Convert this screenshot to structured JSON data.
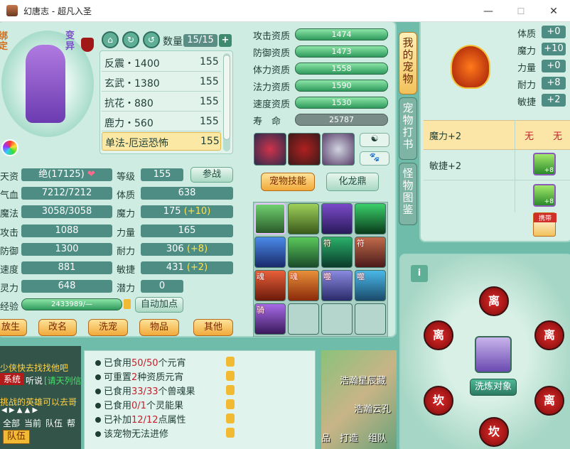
{
  "window": {
    "title": "幻唐志 - 超凡入圣",
    "minimize": "—",
    "maximize": "☐",
    "close": "✕"
  },
  "pet": {
    "tag_bound": "绑定",
    "tag_mutant": "变异",
    "count_label": "数量",
    "count_value": "15/15",
    "add": "+"
  },
  "pet_list": [
    {
      "name": "反震・1400",
      "level": "155"
    },
    {
      "name": "玄武・1380",
      "level": "155"
    },
    {
      "name": "抗花・880",
      "level": "155"
    },
    {
      "name": "鹿力・560",
      "level": "155"
    },
    {
      "name": "单法-厄运恐怖",
      "level": "155"
    }
  ],
  "stats": {
    "talent": {
      "label": "天资",
      "value": "绝(17125)"
    },
    "hp": {
      "label": "气血",
      "value": "7212/7212"
    },
    "mp": {
      "label": "魔法",
      "value": "3058/3058"
    },
    "atk": {
      "label": "攻击",
      "value": "1088"
    },
    "def": {
      "label": "防御",
      "value": "1300"
    },
    "spd": {
      "label": "速度",
      "value": "881"
    },
    "spi": {
      "label": "灵力",
      "value": "648"
    },
    "exp": {
      "label": "经验",
      "value": "2433989/—"
    },
    "level": {
      "label": "等级",
      "value": "155"
    },
    "con": {
      "label": "体质",
      "value": "638"
    },
    "mag": {
      "label": "魔力",
      "value": "175",
      "bonus": "(+10)"
    },
    "str": {
      "label": "力量",
      "value": "165"
    },
    "end": {
      "label": "耐力",
      "value": "306",
      "bonus": "(+8)"
    },
    "agi": {
      "label": "敏捷",
      "value": "431",
      "bonus": "(+2)"
    },
    "pot": {
      "label": "潜力",
      "value": "0"
    },
    "fight_btn": "参战",
    "auto_btn": "自动加点"
  },
  "bottom_buttons": [
    "放生",
    "改名",
    "洗宠",
    "物品",
    "其他"
  ],
  "aptitude": [
    {
      "label": "攻击资质",
      "value": "1474"
    },
    {
      "label": "防御资质",
      "value": "1473"
    },
    {
      "label": "体力资质",
      "value": "1558"
    },
    {
      "label": "法力资质",
      "value": "1590"
    },
    {
      "label": "速度资质",
      "value": "1530"
    },
    {
      "label": "寿　命",
      "value": "25787"
    }
  ],
  "skill_tabs": {
    "skills": "宠物技能",
    "dragon": "化龙鼎"
  },
  "skill_marks": {
    "fu": "符",
    "hun": "魂",
    "shi": "噬",
    "qi": "骑"
  },
  "side_tabs": [
    "我的宠物",
    "宠物打书",
    "怪物图鉴"
  ],
  "wash": {
    "attrs": [
      {
        "label": "体质",
        "value": "+0"
      },
      {
        "label": "魔力",
        "value": "+10"
      },
      {
        "label": "力量",
        "value": "+0"
      },
      {
        "label": "耐力",
        "value": "+8"
      },
      {
        "label": "敏捷",
        "value": "+2"
      }
    ],
    "rows": [
      {
        "text": "魔力+2",
        "a": "无",
        "b": "无"
      },
      {
        "text": "敏捷+2"
      }
    ],
    "badge": "+8",
    "carry": "携带",
    "target": "洗炼对象",
    "info": "i"
  },
  "circles": [
    "离",
    "离",
    "离",
    "坎",
    "离",
    "坎"
  ],
  "notes": [
    {
      "pre": "已食用",
      "hl": "50/50",
      "post": "个元宵"
    },
    {
      "pre": "可重置",
      "hl": "2",
      "post": "种资质元宵"
    },
    {
      "pre": "已食用",
      "hl": "33/33",
      "post": "个兽魂果"
    },
    {
      "pre": "已食用",
      "hl": "0/1",
      "post": "个灵能果"
    },
    {
      "pre": "已补加",
      "hl": "12/12",
      "post": "点属性"
    },
    {
      "pre": "该宠物无法进修",
      "hl": "",
      "post": ""
    }
  ],
  "chat": {
    "line1": "少侠快去找找他吧",
    "sys": "系统",
    "line2a": "听说",
    "line2b": "[请天列信",
    "line3": "挑战的英雄可以去哥",
    "tabs": [
      "全部",
      "当前",
      "队伍",
      "帮"
    ],
    "team": "队伍"
  },
  "map": {
    "text1": "浩瀚星辰藏",
    "text2": "浩瀚云孔",
    "btns": [
      "品",
      "打造",
      "组队"
    ]
  }
}
